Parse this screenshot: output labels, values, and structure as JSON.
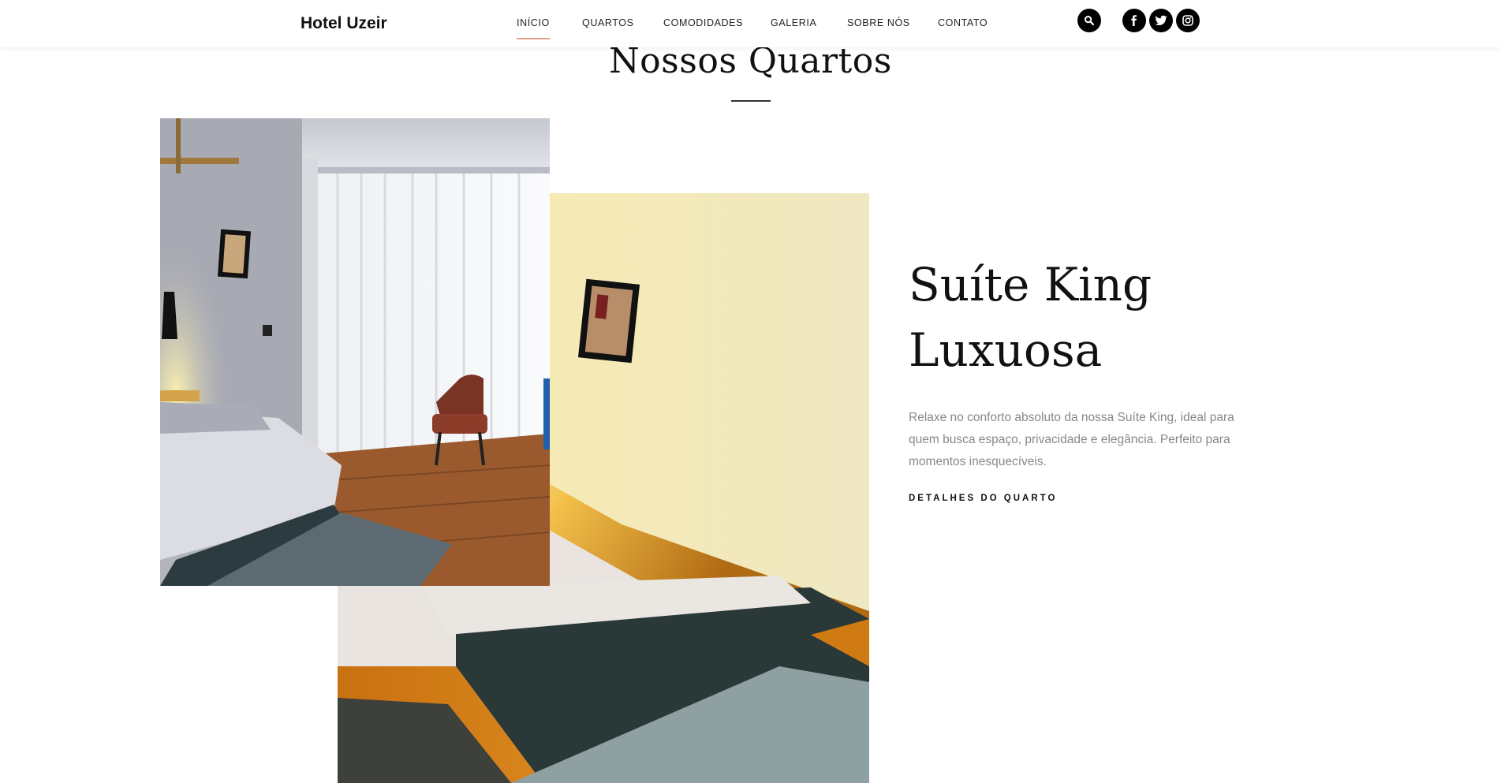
{
  "header": {
    "brand": "Hotel Uzeir",
    "nav": [
      "INÍCIO",
      "QUARTOS",
      "COMODIDADES",
      "GALERIA",
      "SOBRE NÓS",
      "CONTATO"
    ],
    "active_index": 0,
    "icons": [
      "search-icon",
      "facebook-icon",
      "twitter-icon",
      "instagram-icon"
    ]
  },
  "section": {
    "title": "Nossos Quartos"
  },
  "room": {
    "title_line1": "Suíte King",
    "title_line2": "Luxuosa",
    "description": "Relaxe no conforto absoluto da nossa Suíte King, ideal para quem busca espaço, privacidade e elegância. Perfeito para momentos inesquecíveis.",
    "link": "DETALHES DO QUARTO"
  },
  "colors": {
    "accent_underline": "#e0a08a",
    "text_dark": "#111111",
    "text_muted": "#888888"
  }
}
